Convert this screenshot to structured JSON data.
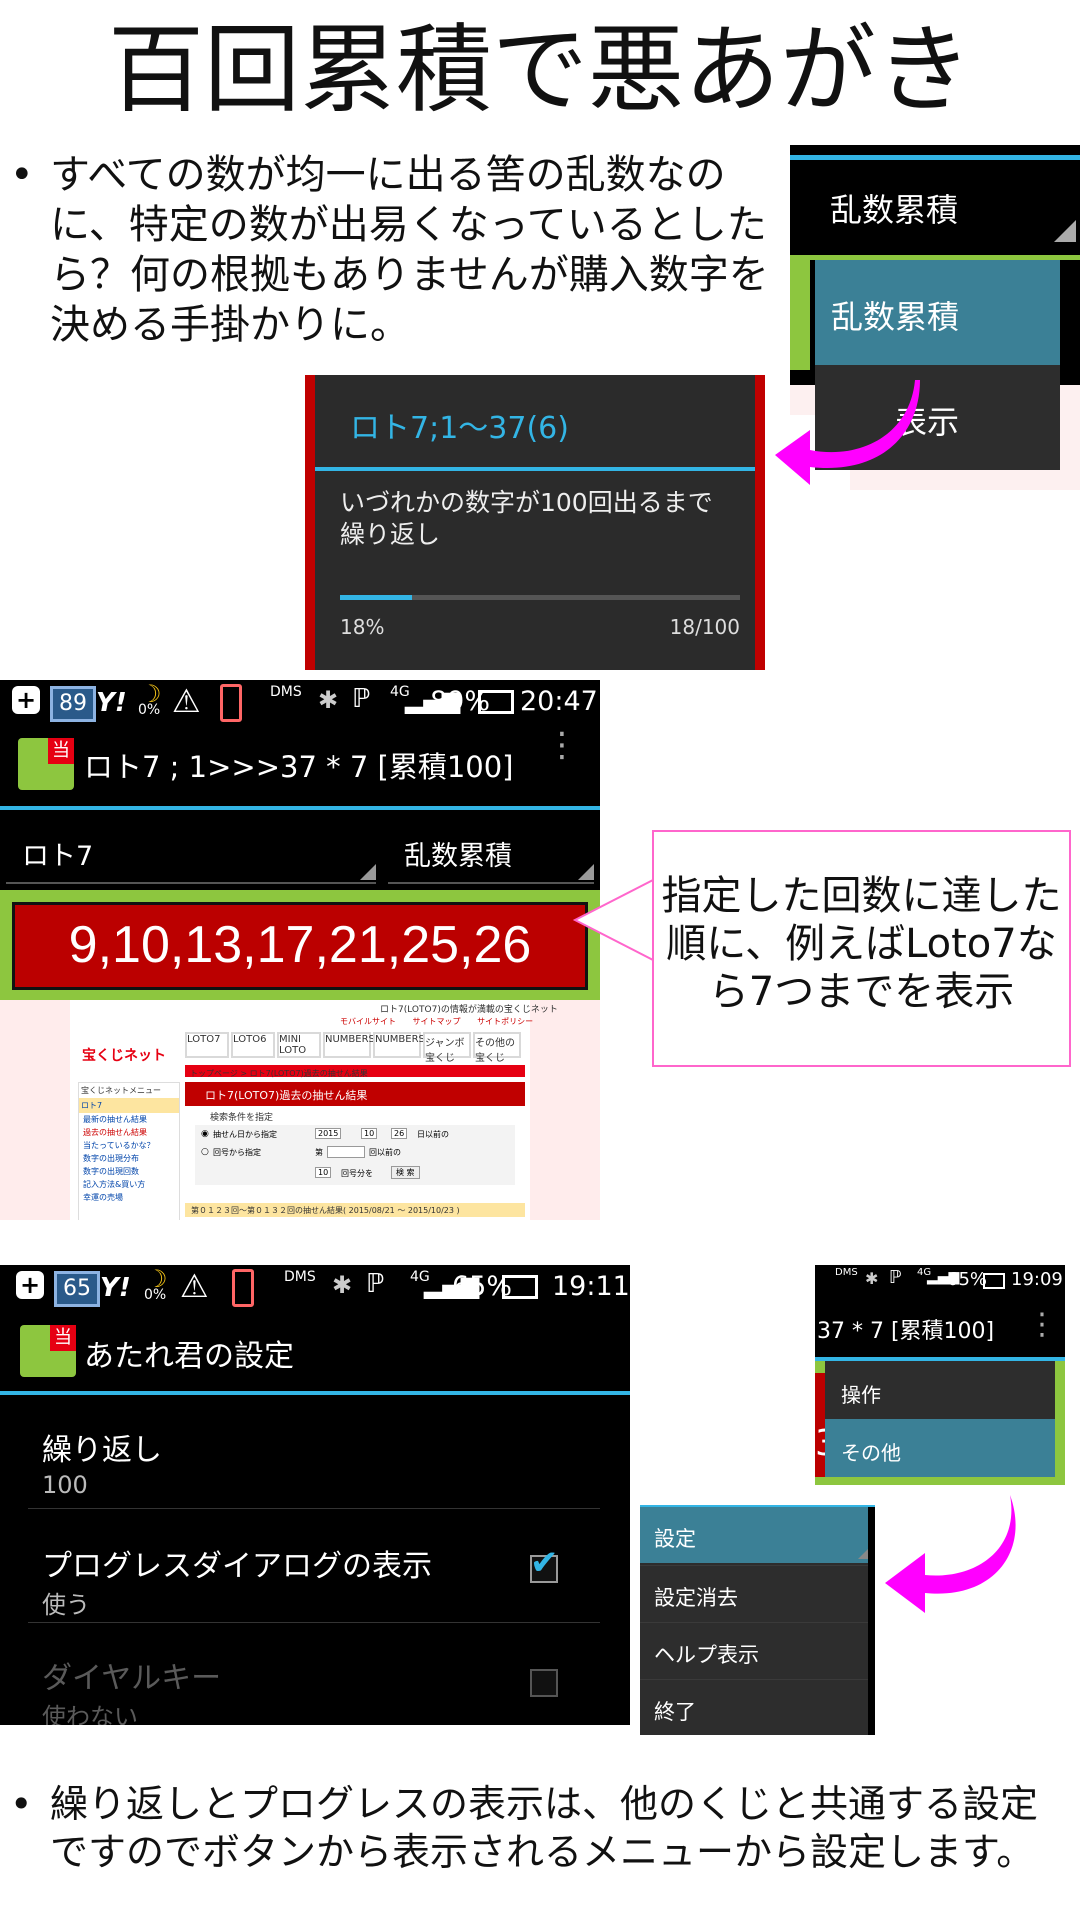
{
  "title": "百回累積で悪あがき",
  "bullet1": {
    "dot": "•",
    "lines": [
      "すべての数が均一に出る筈の乱数なの",
      "に、特定の数が出易くなっているとした",
      "ら？何の根拠もありませんが購入数字を",
      "決める手掛かりに。"
    ]
  },
  "popup_menu1": {
    "spinner_label": "乱数累積",
    "item_selected": "乱数累積",
    "item_partial": "表示"
  },
  "progress_dialog": {
    "title": "ロト7;1～37(6)",
    "message": [
      "いづれかの数字が100回出るまで",
      "繰り返し"
    ],
    "percent_label": "18%",
    "count_label": "18/100",
    "progress": 0.18
  },
  "phone1": {
    "status": {
      "left_icons": "+",
      "badge": "89",
      "yahoo": "Y!",
      "moon_pct": "0%",
      "dms": "DMS",
      "network": "4G",
      "battery": "89%",
      "time": "20:47"
    },
    "appbar_title": "ロト7 ; 1>>>37 * 7 [累積100]",
    "spinner_left": "ロト7",
    "spinner_right": "乱数累積",
    "result_numbers": "9,10,13,17,21,25,26",
    "web": {
      "header_note": "ロト7(LOTO7)の情報が満載の宝くじネット",
      "links": [
        "モバイルサイト",
        "サイトマップ",
        "サイトポリシー"
      ],
      "logo": "宝くじネット",
      "tabs": [
        "LOTO7",
        "LOTO6",
        "MINI LOTO",
        "NUMBERS3",
        "NUMBERS4",
        "ジャンボ宝くじ",
        "その他の宝くじ"
      ],
      "breadcrumb": "トップページ > ロト7(LOTO7)過去の抽せん結果",
      "menu_title": "宝くじネットメニュー",
      "menu_items": [
        "ロト7",
        "最新の抽せん結果",
        "過去の抽せん結果",
        "当たっているかな？",
        "数字の出現分布",
        "数字の出現回数",
        "記入方法&買い方",
        "幸運の売場"
      ],
      "section_title": "ロト7(LOTO7)過去の抽せん結果",
      "search_label": "検索条件を指定",
      "radio1": "抽せん日から指定",
      "radio2": "回号から指定",
      "date_year": "2015",
      "date_month": "10",
      "date_day": "26",
      "date_suffix": "日以前の",
      "kai_prefix": "第",
      "kai_suffix": "回以前の",
      "count_value": "10",
      "count_suffix": "回号分を",
      "search_button": "検 索",
      "footer": "第０１２３回～第０１３２回の抽せん結果( 2015/08/21 ～ 2015/10/23 )"
    }
  },
  "callout": {
    "lines": [
      "指定した回数に達した",
      "順に、例えばLoto7な",
      "ら7つまでを表示"
    ]
  },
  "phone2": {
    "status": {
      "left_icons": "+",
      "badge": "65",
      "yahoo": "Y!",
      "moon_pct": "0%",
      "dms": "DMS",
      "network": "4G",
      "battery": "65%",
      "time": "19:11"
    },
    "appbar_title": "あたれ君の設定",
    "prefs": [
      {
        "title": "繰り返し",
        "summary": "100",
        "enabled": true,
        "checkbox": "none"
      },
      {
        "title": "プログレスダイアログの表示",
        "summary": "使う",
        "enabled": true,
        "checkbox": "checked"
      },
      {
        "title": "ダイヤルキー",
        "summary": "使わない",
        "enabled": false,
        "checkbox": "unchecked"
      }
    ],
    "checkmark": "✔"
  },
  "menu_panel": {
    "status": {
      "dms": "DMS",
      "network": "4G",
      "battery": "65%",
      "time": "19:09"
    },
    "title_fragment": "37 * 7 [累積100]",
    "items": [
      "操作",
      "その他"
    ],
    "left_red_char": "3"
  },
  "submenu": {
    "items": [
      "設定",
      "設定消去",
      "ヘルプ表示",
      "終了"
    ]
  },
  "bullet2": {
    "dot": "•",
    "lines": [
      "繰り返しとプログレスの表示は、他のくじと共通する設定",
      "ですのでボタンから表示されるメニューから設定します。"
    ]
  },
  "colors": {
    "accent": "#33b5e5",
    "magenta": "#ff00ff",
    "green_frame": "#8dc63f",
    "red_result": "#bb0000",
    "menu_selected": "#3b8096"
  }
}
